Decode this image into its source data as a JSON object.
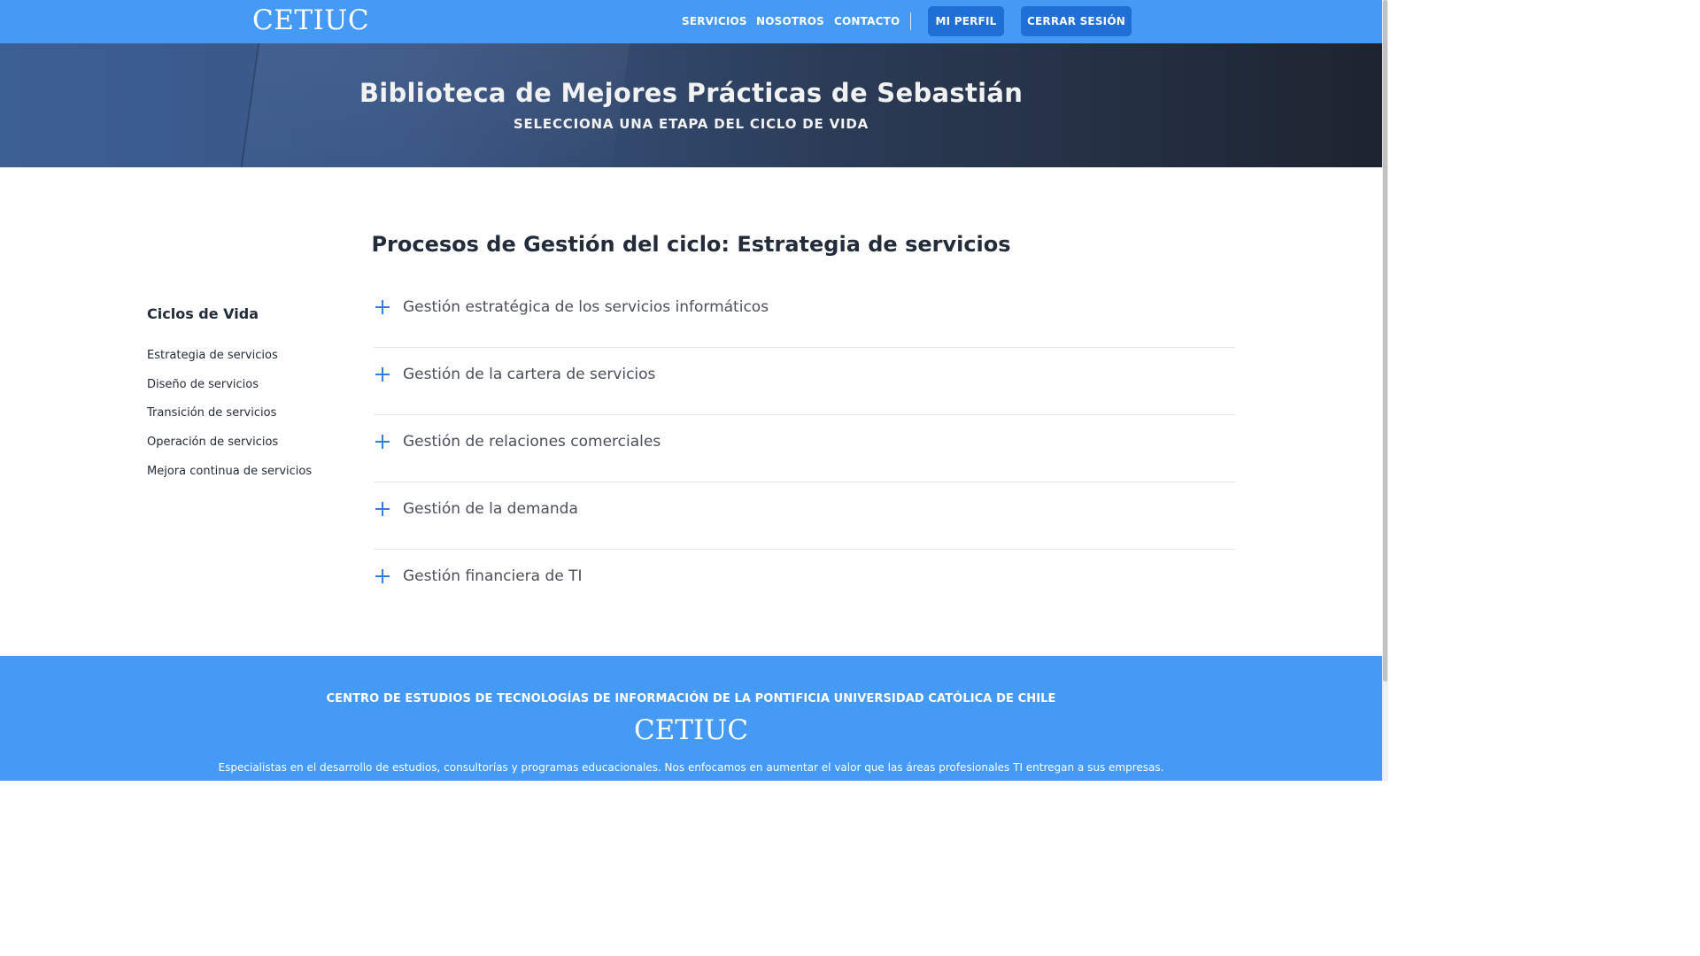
{
  "brand": {
    "logo_text": "CETIUC",
    "accent": "#449af4",
    "button_color": "#1f6fd6",
    "icon_color": "#2f7ee0"
  },
  "nav": {
    "links": [
      "SERVICIOS",
      "NOSOTROS",
      "CONTACTO"
    ],
    "profile_button": "MI PERFIL",
    "logout_button": "CERRAR SESIÓN"
  },
  "hero": {
    "title": "Biblioteca de Mejores Prácticas de Sebastián",
    "subtitle": "SELECCIONA UNA ETAPA DEL CICLO DE VIDA"
  },
  "main": {
    "section_title": "Procesos de Gestión del ciclo: Estrategia de servicios",
    "sidebar": {
      "title": "Ciclos de Vida",
      "items": [
        "Estrategia de servicios",
        "Diseño de servicios",
        "Transición de servicios",
        "Operación de servicios",
        "Mejora continua de servicios"
      ]
    },
    "accordion": {
      "icon": "plus-icon",
      "items": [
        "Gestión estratégica de los servicios informáticos",
        "Gestión de la cartera de servicios",
        "Gestión de relaciones comerciales",
        "Gestión de la demanda",
        "Gestión financiera de TI"
      ]
    }
  },
  "footer": {
    "heading": "CENTRO DE ESTUDIOS DE TECNOLOGÍAS DE INFORMACIÓN DE LA PONTIFICIA UNIVERSIDAD CATÓLICA DE CHILE",
    "logo_text": "CETIUC",
    "description": "Especialistas en el desarrollo de estudios, consultorías y programas educacionales. Nos enfocamos en aumentar el valor que las áreas profesionales TI entregan a sus empresas."
  }
}
